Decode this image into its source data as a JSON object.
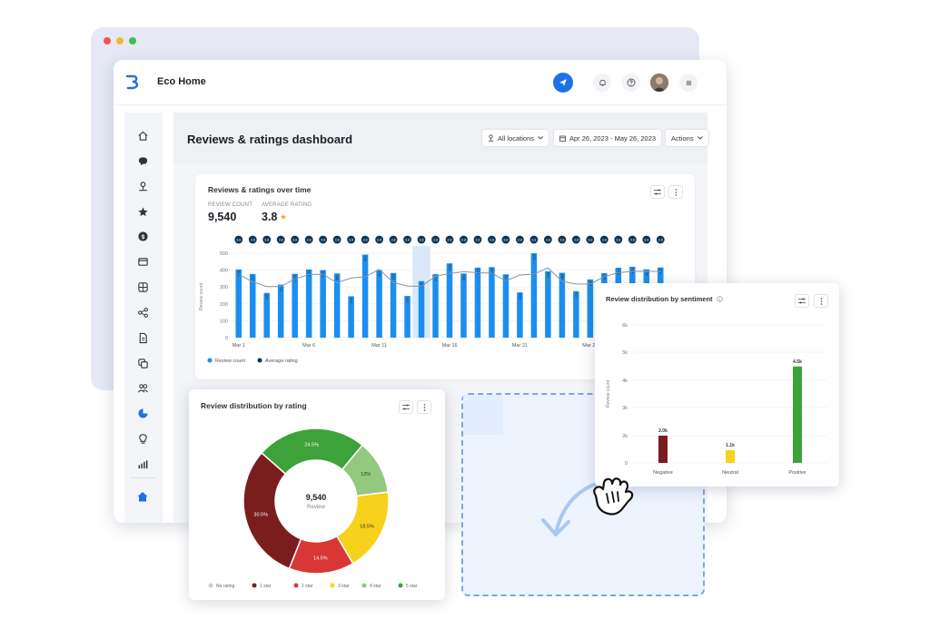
{
  "app": {
    "title": "Eco Home"
  },
  "page": {
    "title": "Reviews & ratings dashboard",
    "location_filter": "All locations",
    "date_range": "Apr 26, 2023 - May 26, 2023",
    "actions_label": "Actions"
  },
  "time_card": {
    "title": "Reviews & ratings over time",
    "review_count_label": "REVIEW COUNT",
    "review_count": "9,540",
    "avg_rating_label": "AVERAGE RATING",
    "avg_rating": "3.8",
    "ylabel": "Review count",
    "legend_count": "Review count",
    "legend_avg": "Average rating"
  },
  "rating_card": {
    "title": "Review distribution by rating",
    "center_value": "9,540",
    "center_label": "Review"
  },
  "sentiment_card": {
    "title": "Review distribution by sentiment",
    "ylabel": "Review count"
  },
  "colors": {
    "brand_blue": "#1d72e8",
    "bar_blue": "#1a8ff0",
    "avg_dot": "#0c3454",
    "star": "#f5a623"
  },
  "chart_data": [
    {
      "type": "bar",
      "title": "Reviews & ratings over time",
      "xlabel": "",
      "ylabel": "Review count",
      "ylim": [
        0,
        500
      ],
      "yticks": [
        0,
        100,
        200,
        300,
        400,
        500
      ],
      "xticks": [
        "Mar 1",
        "Mar 6",
        "Mar 11",
        "Mar 16",
        "Mar 21",
        "Mar 26"
      ],
      "series": [
        {
          "name": "Review count",
          "values": [
            404,
            377,
            265,
            314,
            378,
            404,
            400,
            380,
            245,
            492,
            401,
            383,
            247,
            335,
            376,
            440,
            380,
            415,
            418,
            375,
            268,
            528,
            393,
            384,
            275,
            345,
            382,
            414,
            420,
            405,
            416
          ]
        },
        {
          "name": "Average rating",
          "values": [
            3.8,
            3.8,
            3.8,
            3.8,
            3.8,
            3.8,
            3.8,
            3.8,
            3.8,
            3.8,
            3.8,
            3.8,
            3.8,
            3.8,
            3.8,
            3.8,
            3.8,
            3.8,
            3.8,
            3.8,
            3.8,
            3.8,
            3.8,
            3.8,
            3.8,
            3.8,
            3.8,
            3.8,
            3.8,
            3.8,
            3.8
          ]
        }
      ],
      "legend": "bottom-left",
      "grid": true
    },
    {
      "type": "pie",
      "title": "Review distribution by rating",
      "categories": [
        "No rating",
        "1 star",
        "2 star",
        "3 star",
        "4 star",
        "5 star"
      ],
      "values": [
        0,
        30.5,
        14.5,
        18.5,
        12,
        24.5
      ],
      "labels": [
        "",
        "30.5%",
        "14.5%",
        "18.5%",
        "12%",
        "24.5%"
      ],
      "colors": [
        "#cccccc",
        "#7a1d1d",
        "#d93636",
        "#f6d21c",
        "#92c97e",
        "#3ea23a"
      ],
      "legend": "bottom"
    },
    {
      "type": "bar",
      "title": "Review distribution by sentiment",
      "categories": [
        "Negative",
        "Neutral",
        "Positive"
      ],
      "values": [
        2000,
        1100,
        4500
      ],
      "labels": [
        "2.0k",
        "1.1k",
        "4.5k"
      ],
      "colors": [
        "#7a1d1d",
        "#f6d21c",
        "#3ea23a"
      ],
      "ylabel": "Review count",
      "ylim": [
        0,
        6000
      ],
      "yticks": [
        "0",
        "2k",
        "3k",
        "4k",
        "5k",
        "6k"
      ],
      "grid": true
    }
  ]
}
